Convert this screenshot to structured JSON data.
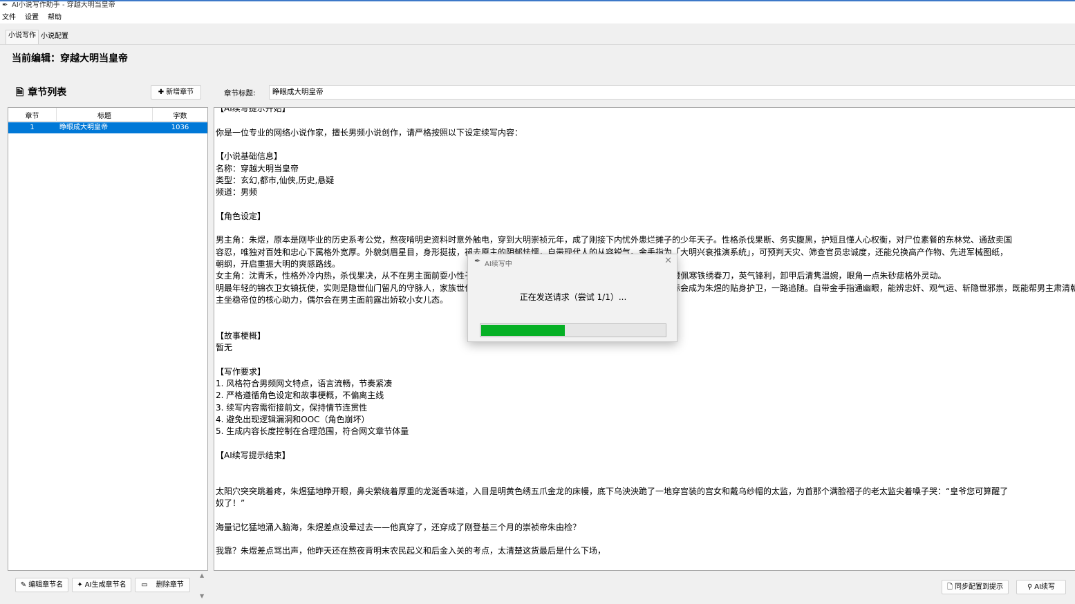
{
  "window": {
    "title": "AI小说写作助手 - 穿越大明当皇帝",
    "icon": "feather-pen-icon"
  },
  "menu": [
    "文件",
    "设置",
    "帮助"
  ],
  "tabs": [
    {
      "label": "小说写作",
      "active": true
    },
    {
      "label": "小说配置",
      "active": false
    }
  ],
  "current_edit": "当前编辑：穿越大明当皇帝",
  "chapter_list": {
    "title": "章节列表",
    "add_button": "新增章节",
    "columns": [
      "章节",
      "标题",
      "字数"
    ],
    "rows": [
      {
        "chapter": "1",
        "title": "睁眼成大明皇帝",
        "words": "1036",
        "selected": true
      }
    ]
  },
  "chapter_title_label": "章节标题:",
  "chapter_title_value": "睁眼成大明皇帝",
  "editor_lines": [
    "【AI续写提示开始】",
    "",
    "    你是一位专业的网络小说作家，擅长男频小说创作，请严格按照以下设定续写内容：",
    "",
    "    【小说基础信息】",
    "    名称：穿越大明当皇帝",
    "    类型：玄幻,都市,仙侠,历史,悬疑",
    "    频道：男频",
    "",
    "    【角色设定】",
    "",
    "男主角：朱煜，原本是刚毕业的历史系考公党，熬夜啃明史资料时意外触电，穿到大明崇祯元年，成了刚接下内忧外患烂摊子的少年天子。性格杀伐果断、务实腹黑，护短且懂人心权衡，对尸位素餐的东林党、通敌卖国",
    "容忍，唯独对百姓和忠心下属格外宽厚。外貌剑眉星目，身形挺拔，褪去原主的阴郁怯懦，自带现代人的从容锐气。金手指为「大明兴衰推演系统」，可预判天灾、筛查官员忠诚度，还能兑换高产作物、先进军械图纸，",
    "朝纲，开启重振大明的爽感路线。",
    "女主角：沈青禾，性格外冷内热，杀伐果决，从不在男主面前耍小性子，宫中人称“冷面女官”，身着常束高马尾，穿飞鱼服时腰佩寒铁绣春刀，英气锋利，卸甲后清隽温婉，眼角一点朱砂痣格外灵动。",
    "明最年轻的锦衣卫女镇抚使，实则是隐世仙门留凡的守脉人，家族世代守护大明龙脉气运，此次入世只为追随天命之主，因缘际会成为朱煜的贴身护卫，一路追随。自带金手指通幽眼，能辨忠奸、观气运、斩隐世邪祟，既能帮男主肃清朝堂蛀虫，又能破解宫廷",
    "主坐稳帝位的核心助力，偶尔会在男主面前露出娇软小女儿态。",
    "",
    "",
    "    【故事梗概】",
    "    暂无",
    "",
    "    【写作要求】",
    "    1. 风格符合男频网文特点，语言流畅，节奏紧凑",
    "    2. 严格遵循角色设定和故事梗概，不偏离主线",
    "    3. 续写内容需衔接前文，保持情节连贯性",
    "    4. 避免出现逻辑漏洞和OOC（角色崩坏）",
    "    5. 生成内容长度控制在合理范围，符合网文章节体量",
    "",
    "【AI续写提示结束】",
    "",
    "",
    "太阳穴突突跳着疼，朱煜猛地睁开眼，鼻尖萦绕着厚重的龙涎香味道，入目是明黄色绣五爪金龙的床幔，底下乌泱泱跪了一地穿宫装的宫女和戴乌纱帽的太监，为首那个满脸褶子的老太监尖着嗓子哭：“皇爷您可算醒了",
    "奴了！”",
    "",
    "海量记忆猛地涌入脑海，朱煜差点没晕过去——他真穿了，还穿成了刚登基三个月的崇祯帝朱由检？",
    "",
    "我靠？朱煜差点骂出声，他昨天还在熬夜背明末农民起义和后金入关的考点，太清楚这货最后是什么下场，"
  ],
  "bottom_left_buttons": [
    {
      "label": "编辑章节名",
      "icon": "pencil-icon"
    },
    {
      "label": "AI生成章节名",
      "icon": "sparkle-icon"
    },
    {
      "label": "删除章节",
      "icon": "trash-icon"
    }
  ],
  "bottom_right_buttons": [
    {
      "label": "同步配置到提示",
      "icon": "sync-doc-icon"
    },
    {
      "label": "AI续写",
      "icon": "lightbulb-icon"
    }
  ],
  "dialog": {
    "title": "AI续写中",
    "message": "正在发送请求（尝试 1/1）...",
    "progress_percent": 45,
    "close_icon": "close-icon"
  },
  "colors": {
    "selection": "#0078d7",
    "progress": "#06b025",
    "titlebar_accent": "#3c78c8"
  }
}
